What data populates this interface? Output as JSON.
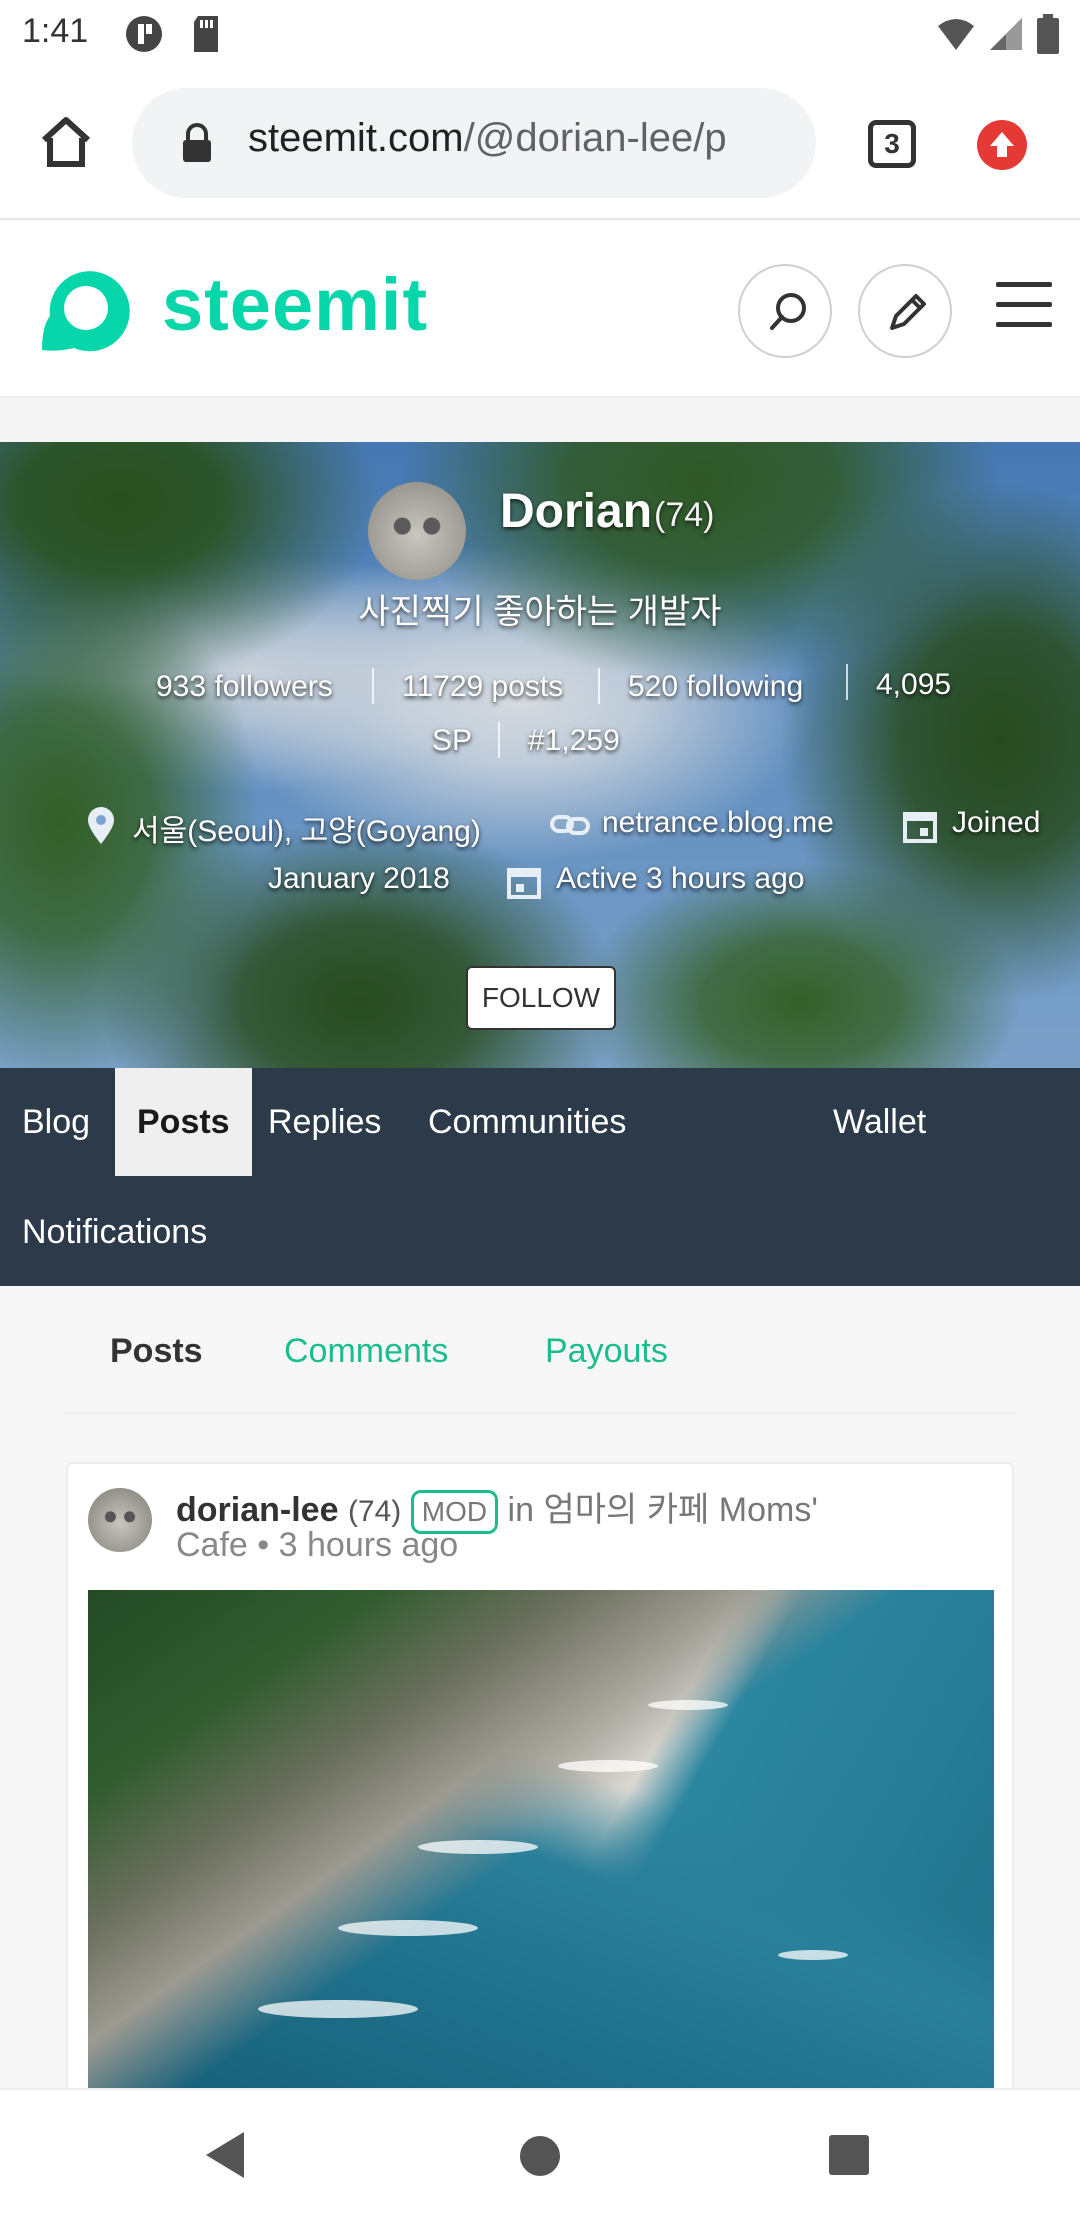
{
  "status_bar": {
    "time": "1:41"
  },
  "browser": {
    "url_main": "steemit.com",
    "url_rest": "/@dorian-lee/p",
    "tab_count": "3"
  },
  "site": {
    "logo_text": "steemit",
    "accent": "#06d6a9"
  },
  "profile": {
    "name": "Dorian",
    "reputation": "(74)",
    "bio": "사진찍기 좋아하는 개발자",
    "followers": "933 followers",
    "posts": "11729 posts",
    "following": "520 following",
    "sp_value": "4,095",
    "sp_unit": "SP",
    "rank": "#1,259",
    "location": "서울(Seoul), 고양(Goyang)",
    "website": "netrance.blog.me",
    "joined_label": "Joined",
    "joined_date": "January 2018",
    "active": "Active 3 hours ago",
    "follow_label": "FOLLOW"
  },
  "nav_tabs": {
    "blog": "Blog",
    "posts": "Posts",
    "replies": "Replies",
    "communities": "Communities",
    "wallet": "Wallet",
    "notifications": "Notifications"
  },
  "sub_tabs": {
    "posts": "Posts",
    "comments": "Comments",
    "payouts": "Payouts"
  },
  "post": {
    "author": "dorian-lee",
    "reputation": "(74)",
    "badge": "MOD",
    "in_label": "in",
    "community_korean": "엄마의 카페",
    "community_english_1": "Moms'",
    "community_english_2": "Cafe",
    "time": "3 hours ago"
  }
}
